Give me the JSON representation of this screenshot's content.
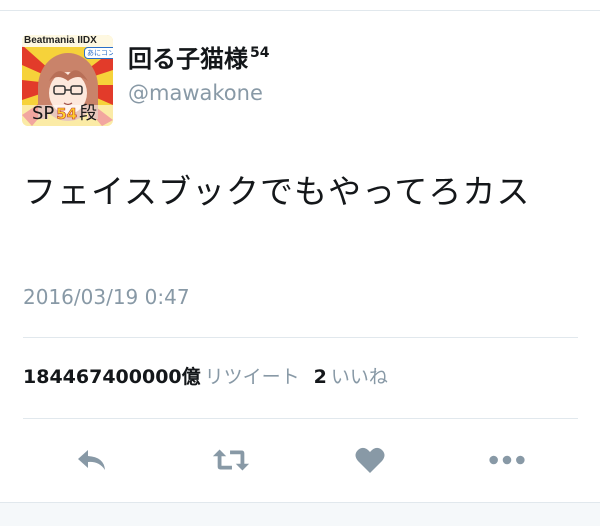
{
  "tweet": {
    "display_name": "回る子猫様",
    "name_superscript": "54",
    "handle": "@mawakone",
    "text": "フェイスブックでもやってろカス",
    "timestamp": "2016/03/19 0:47"
  },
  "stats": {
    "retweet_count": "184467400000億",
    "retweet_label": "リツイート",
    "like_count": "2",
    "like_label": "いいね"
  },
  "avatar": {
    "top_text": "Beatmania IIDX",
    "badge_text": "あにコン",
    "rank_prefix": "SP",
    "rank_number": "54",
    "rank_suffix": "段"
  },
  "actions": [
    {
      "name": "reply",
      "icon": "reply-icon"
    },
    {
      "name": "retweet",
      "icon": "retweet-icon"
    },
    {
      "name": "like",
      "icon": "heart-icon"
    },
    {
      "name": "more",
      "icon": "more-icon"
    }
  ],
  "colors": {
    "text_primary": "#14171a",
    "text_secondary": "#8899a6",
    "divider": "#e1e8ed",
    "icon": "#8899a6"
  }
}
